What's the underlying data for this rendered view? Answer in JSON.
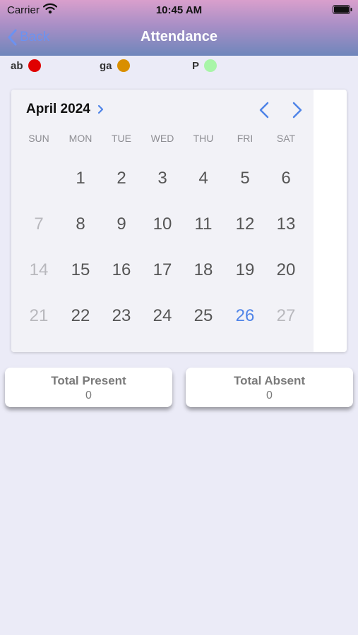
{
  "status_bar": {
    "carrier": "Carrier",
    "time": "10:45 AM"
  },
  "nav": {
    "back_label": "Back",
    "title": "Attendance",
    "back_color": "#6b92f1"
  },
  "legend": [
    {
      "label": "ab",
      "color": "#e00000"
    },
    {
      "label": "ga",
      "color": "#d98f00"
    },
    {
      "label": "P",
      "color": "#a8f5a8"
    }
  ],
  "calendar": {
    "month_label": "April 2024",
    "weekdays": [
      "SUN",
      "MON",
      "TUE",
      "WED",
      "THU",
      "FRI",
      "SAT"
    ],
    "weeks": [
      [
        "",
        "1",
        "2",
        "3",
        "4",
        "5",
        "6"
      ],
      [
        "7",
        "8",
        "9",
        "10",
        "11",
        "12",
        "13"
      ],
      [
        "14",
        "15",
        "16",
        "17",
        "18",
        "19",
        "20"
      ],
      [
        "21",
        "22",
        "23",
        "24",
        "25",
        "26",
        "27"
      ]
    ],
    "today": "26",
    "accent_color": "#4f84e8"
  },
  "totals": {
    "present_label": "Total Present",
    "present_value": "0",
    "absent_label": "Total Absent",
    "absent_value": "0"
  }
}
